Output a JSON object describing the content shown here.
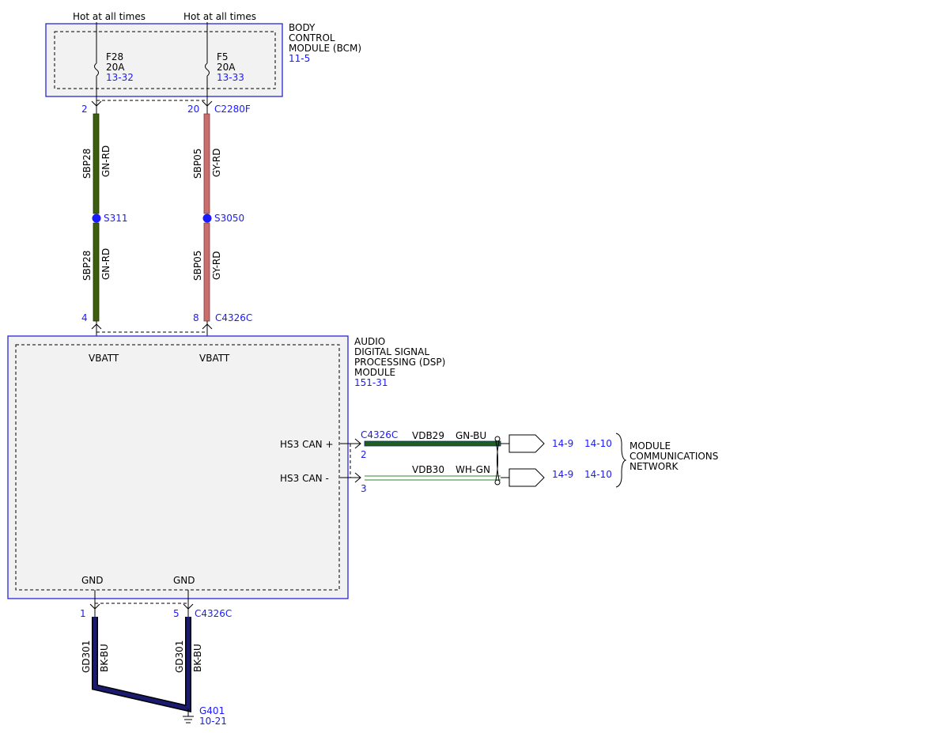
{
  "bcm": {
    "name_lines": [
      "BODY",
      "CONTROL",
      "MODULE (BCM)"
    ],
    "ref": "11-5",
    "feeds": [
      {
        "label": "Hot at all times",
        "fuse": "F28",
        "amps": "20A",
        "ref": "13-32"
      },
      {
        "label": "Hot at all times",
        "fuse": "F5",
        "amps": "20A",
        "ref": "13-33"
      }
    ],
    "pins": [
      "2",
      "20"
    ],
    "connector": "C2280F"
  },
  "wires": {
    "left_top": {
      "circuit": "SBP28",
      "color": "GN-RD",
      "hex": "#3d5e0e"
    },
    "right_top": {
      "circuit": "SBP05",
      "color": "GY-RD",
      "hex": "#c86e6e"
    },
    "left_bot": {
      "circuit": "SBP28",
      "color": "GN-RD",
      "hex": "#3d5e0e"
    },
    "right_bot": {
      "circuit": "SBP05",
      "color": "GY-RD",
      "hex": "#c86e6e"
    },
    "gnd_left": {
      "circuit": "GD301",
      "color": "BK-BU",
      "hex": "#10104a"
    },
    "gnd_right": {
      "circuit": "GD301",
      "color": "BK-BU",
      "hex": "#10104a"
    }
  },
  "splices": [
    "S311",
    "S3050"
  ],
  "dsp": {
    "name_lines": [
      "AUDIO",
      "DIGITAL SIGNAL",
      "PROCESSING (DSP)",
      "MODULE"
    ],
    "ref": "151-31",
    "top_pins": [
      "4",
      "8"
    ],
    "top_connector": "C4326C",
    "vbatt": [
      "VBATT",
      "VBATT"
    ],
    "can_connector": "C4326C",
    "can": [
      {
        "label": "HS3 CAN +",
        "pin": "2",
        "circuit": "VDB29",
        "color": "GN-BU",
        "ref1": "14-9",
        "ref2": "14-10"
      },
      {
        "label": "HS3 CAN -",
        "pin": "3",
        "circuit": "VDB30",
        "color": "WH-GN",
        "ref1": "14-9",
        "ref2": "14-10"
      }
    ],
    "gnd": [
      "GND",
      "GND"
    ],
    "gnd_pins": [
      "1",
      "5"
    ],
    "gnd_connector": "C4326C"
  },
  "network": {
    "lines": [
      "MODULE",
      "COMMUNICATIONS",
      "NETWORK"
    ]
  },
  "ground": {
    "id": "G401",
    "ref": "10-21"
  }
}
